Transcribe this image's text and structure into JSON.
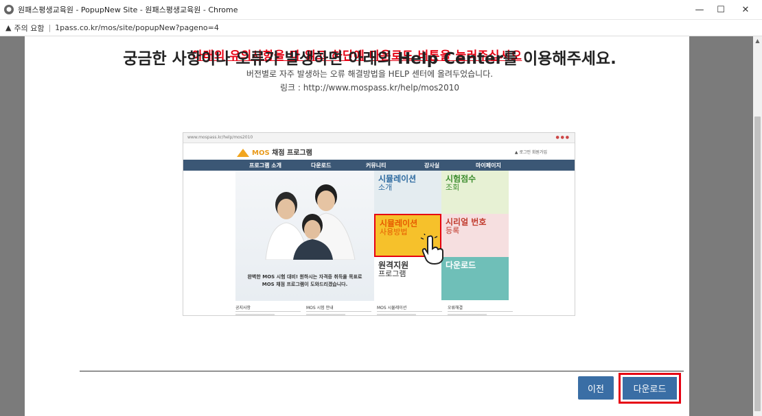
{
  "window": {
    "title": "원패스평생교육원 - PopupNew Site - 원패스평생교육원 - Chrome",
    "controls": {
      "minimize": "—",
      "maximize": "☐",
      "close": "✕"
    }
  },
  "address_bar": {
    "warning_icon": "▲",
    "warning_label": "주의 요함",
    "separator": "|",
    "url": "1pass.co.kr/mos/site/popupNew?pageno=4"
  },
  "popup": {
    "notice": "아래의 유의사항을 다 읽고 하단에 다운로드 버튼을 눌러주십시오",
    "help_title": "궁금한 사항이나 오류가 발생하면 아래의 Help Center를 이용해주세요.",
    "help_sub": "버전별로 자주 발생하는 오류 해결방법을 HELP 센터에 올려두었습니다.",
    "help_link": "링크 : http://www.mospass.kr/help/mos2010"
  },
  "embedded_site": {
    "browser_url": "www.mospass.kr/help/mos2010",
    "logo_brand": "MOS",
    "logo_text": " 채점 프로그램",
    "top_links": "▲  로그인   회원가입",
    "nav": [
      "프로그램 소개",
      "다운로드",
      "커뮤니티",
      "강사실",
      "마이페이지"
    ],
    "hero_caption_1": "완벽한 MOS 시험 대비! 원하시는 자격증 취득을 목표로",
    "hero_caption_2": "MOS 채점 프로그램이 도와드리겠습니다.",
    "tiles": {
      "sim": {
        "t1": "시뮬레이션",
        "t2": "소개"
      },
      "score": {
        "t1": "시험점수",
        "t2": "조회"
      },
      "howto": {
        "t1": "시뮬레이션",
        "t2": "사용방법"
      },
      "serial": {
        "t1": "시리얼 번호",
        "t2": "등록"
      },
      "remote": {
        "t1": "원격지원",
        "t2": "프로그램"
      },
      "download": {
        "t1": "다운로드"
      }
    },
    "lists": [
      "공지사항",
      "MOS 시험 안내",
      "MOS 시뮬레이션",
      "오류해결"
    ]
  },
  "buttons": {
    "prev": "이전",
    "download": "다운로드"
  },
  "colors": {
    "notice": "#e60012",
    "button": "#3a6ea5",
    "highlight": "#e60012"
  }
}
